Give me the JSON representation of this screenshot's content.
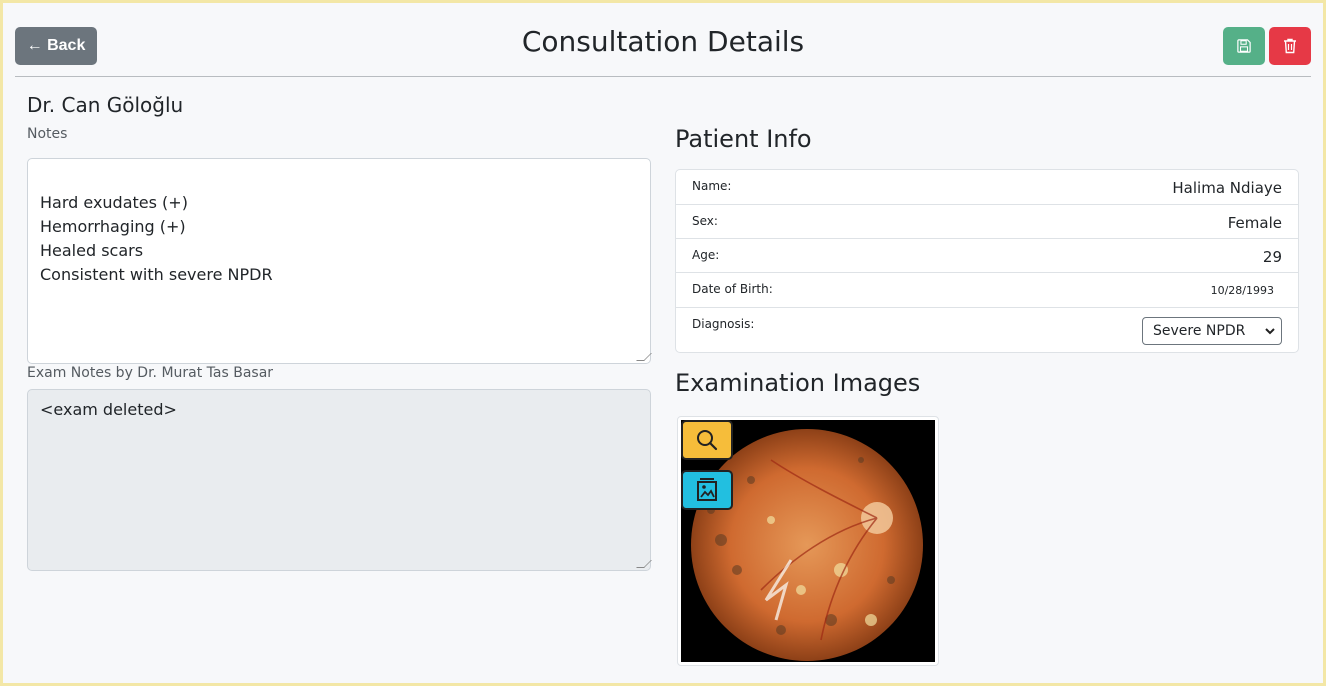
{
  "header": {
    "back_label": "← Back",
    "title": "Consultation Details",
    "save_icon": "floppy-disk-icon",
    "delete_icon": "trash-icon"
  },
  "consultation": {
    "doctor_name": "Dr. Can Göloğlu",
    "notes_label": "Notes",
    "notes_value": "Hard exudates (+)\nHemorrhaging (+)\nHealed scars\nConsistent with severe NPDR",
    "exam_notes_label": "Exam Notes by Dr. Murat Tas Basar",
    "exam_notes_value": "<exam deleted>"
  },
  "patient_info": {
    "title": "Patient Info",
    "rows": [
      {
        "label": "Name:",
        "value": "Halima Ndiaye"
      },
      {
        "label": "Sex:",
        "value": "Female"
      },
      {
        "label": "Age:",
        "value": "29"
      },
      {
        "label": "Date of Birth:",
        "value": "10/28/1993"
      },
      {
        "label": "Diagnosis:",
        "value": "Severe NPDR"
      }
    ]
  },
  "examination_images": {
    "title": "Examination Images",
    "zoom_icon": "magnifier-icon",
    "image_icon": "image-icon"
  },
  "colors": {
    "back": "#6c757d",
    "save": "#55b088",
    "delete": "#e63946",
    "zoom": "#f6bd3a",
    "image": "#22bfe0"
  }
}
